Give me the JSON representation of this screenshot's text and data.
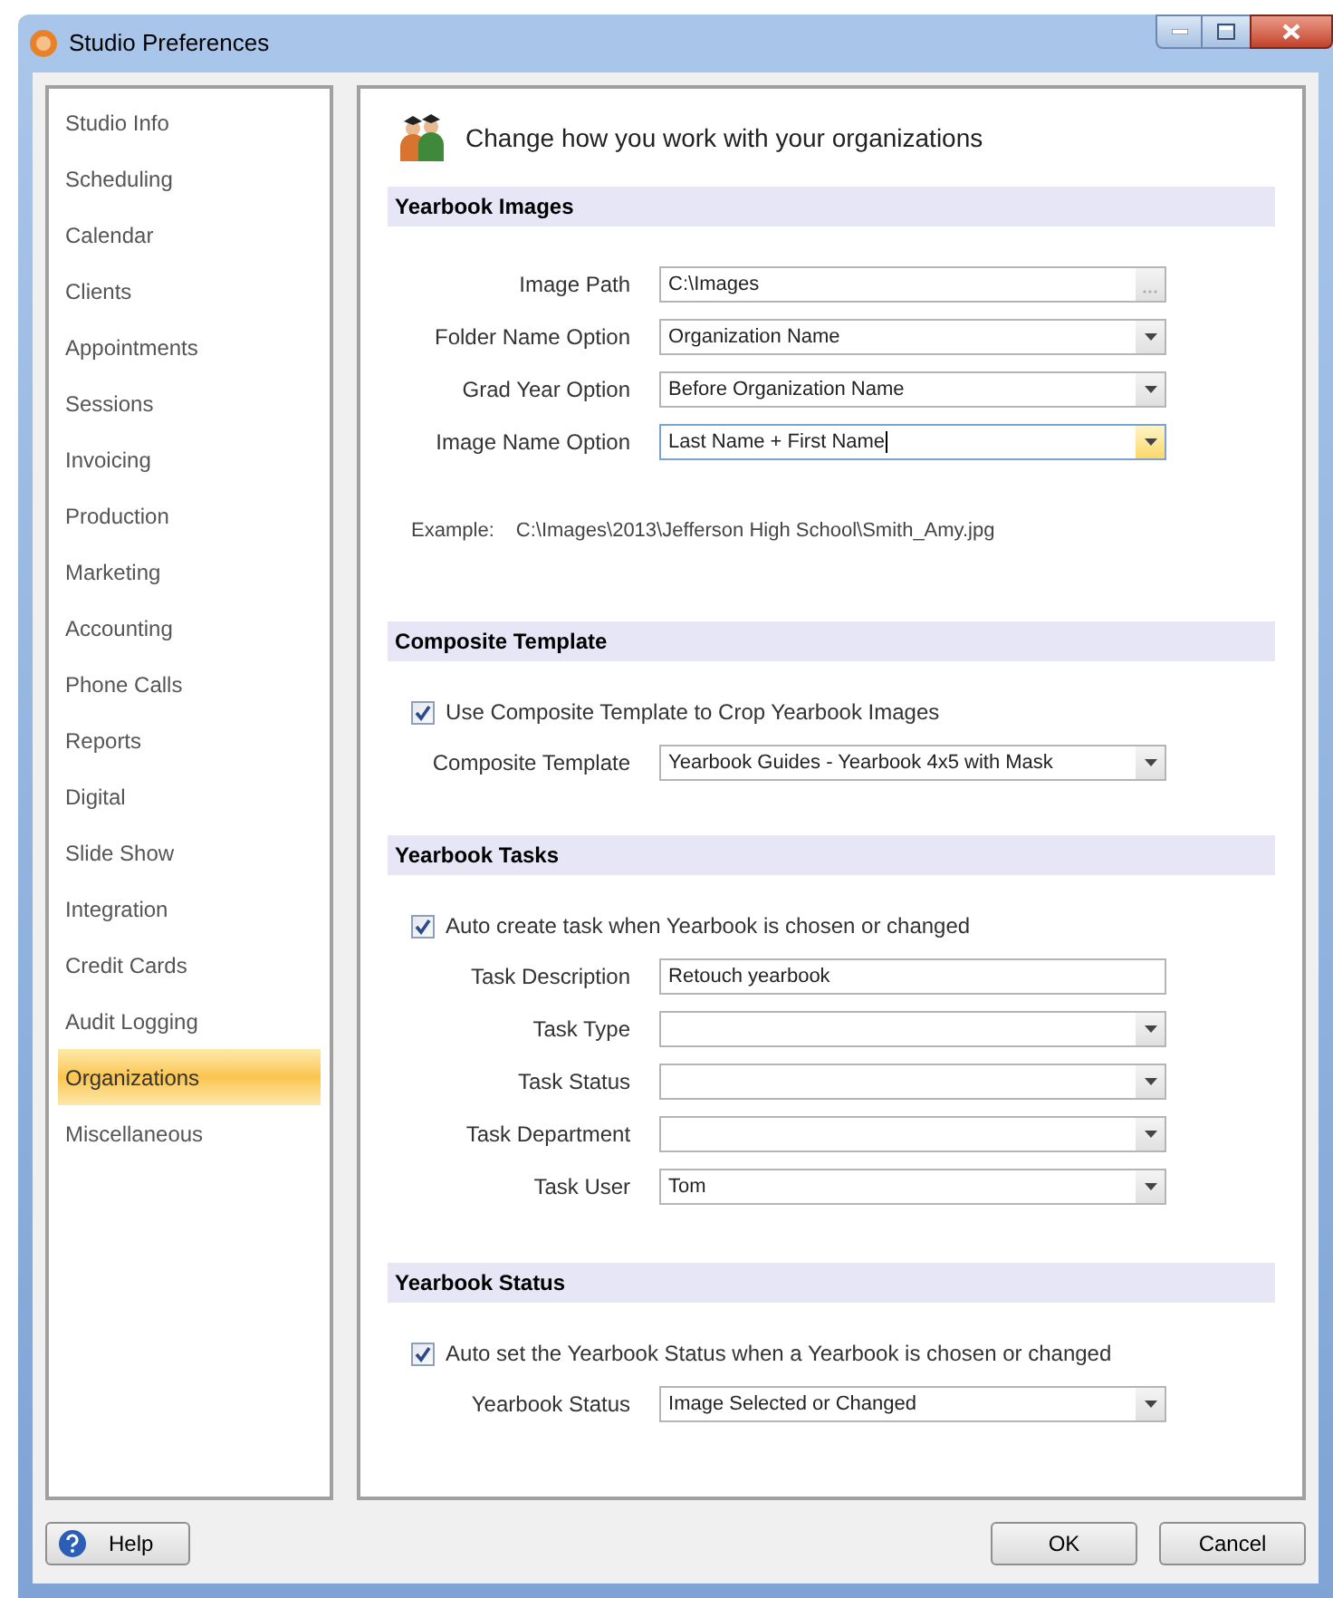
{
  "window": {
    "title": "Studio Preferences"
  },
  "sidebar": {
    "items": [
      {
        "label": "Studio Info",
        "selected": false
      },
      {
        "label": "Scheduling",
        "selected": false
      },
      {
        "label": "Calendar",
        "selected": false
      },
      {
        "label": "Clients",
        "selected": false
      },
      {
        "label": "Appointments",
        "selected": false
      },
      {
        "label": "Sessions",
        "selected": false
      },
      {
        "label": "Invoicing",
        "selected": false
      },
      {
        "label": "Production",
        "selected": false
      },
      {
        "label": "Marketing",
        "selected": false
      },
      {
        "label": "Accounting",
        "selected": false
      },
      {
        "label": "Phone Calls",
        "selected": false
      },
      {
        "label": "Reports",
        "selected": false
      },
      {
        "label": "Digital",
        "selected": false
      },
      {
        "label": "Slide Show",
        "selected": false
      },
      {
        "label": "Integration",
        "selected": false
      },
      {
        "label": "Credit Cards",
        "selected": false
      },
      {
        "label": "Audit Logging",
        "selected": false
      },
      {
        "label": "Organizations",
        "selected": true
      },
      {
        "label": "Miscellaneous",
        "selected": false
      }
    ]
  },
  "header": {
    "text": "Change how you work with your organizations"
  },
  "sections": [
    {
      "title": "Yearbook Images",
      "rows": [
        {
          "kind": "browse",
          "label": "Image Path",
          "value": "C:\\Images",
          "focused": false
        },
        {
          "kind": "dropdown",
          "label": "Folder Name Option",
          "value": "Organization Name",
          "focused": false
        },
        {
          "kind": "dropdown",
          "label": "Grad Year Option",
          "value": "Before Organization Name",
          "focused": false
        },
        {
          "kind": "dropdown",
          "label": "Image Name Option",
          "value": "Last Name + First Name",
          "focused": true
        },
        {
          "kind": "example",
          "label": "Example:",
          "value": "C:\\Images\\2013\\Jefferson High School\\Smith_Amy.jpg"
        }
      ]
    },
    {
      "title": "Composite Template",
      "rows": [
        {
          "kind": "checkbox",
          "label": "Use Composite Template to Crop Yearbook Images",
          "checked": true
        },
        {
          "kind": "dropdown",
          "label": "Composite Template",
          "value": "Yearbook Guides - Yearbook 4x5 with Mask",
          "focused": false
        }
      ]
    },
    {
      "title": "Yearbook Tasks",
      "rows": [
        {
          "kind": "checkbox",
          "label": "Auto create task when Yearbook is chosen or changed",
          "checked": true
        },
        {
          "kind": "text",
          "label": "Task Description",
          "value": "Retouch yearbook",
          "focused": false
        },
        {
          "kind": "dropdown",
          "label": "Task Type",
          "focused": false
        },
        {
          "kind": "dropdown",
          "label": "Task Status",
          "focused": false
        },
        {
          "kind": "dropdown",
          "label": "Task Department",
          "focused": false
        },
        {
          "kind": "dropdown",
          "label": "Task User",
          "value": "Tom",
          "focused": false
        }
      ]
    },
    {
      "title": "Yearbook Status",
      "rows": [
        {
          "kind": "checkbox",
          "label": "Auto set the Yearbook Status when a Yearbook is chosen or changed",
          "checked": true
        },
        {
          "kind": "dropdown",
          "label": "Yearbook Status",
          "value": "Image Selected or Changed",
          "focused": false
        }
      ]
    }
  ],
  "buttons": {
    "help": "Help",
    "ok": "OK",
    "cancel": "Cancel"
  }
}
